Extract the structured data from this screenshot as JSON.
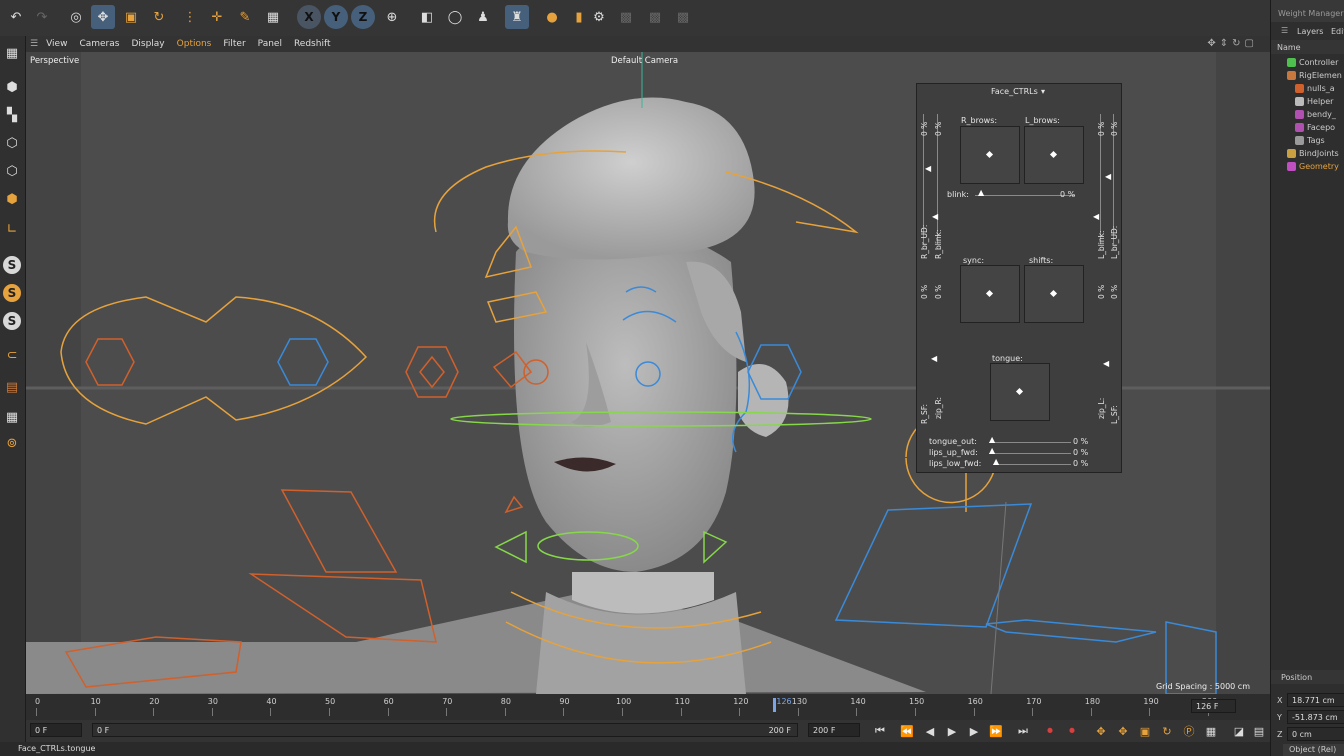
{
  "toolbar": {
    "icons": [
      "undo-icon",
      "redo-icon",
      "live-selection-icon",
      "move-icon",
      "scale-icon",
      "rotate-icon",
      "recent-tools-icon",
      "add-icon",
      "brush-icon",
      "checker-icon"
    ],
    "axes": {
      "x": "X",
      "y": "Y",
      "z": "Z"
    },
    "accent": "#46607c"
  },
  "viewport": {
    "menu": [
      "View",
      "Cameras",
      "Display",
      "Options",
      "Filter",
      "Panel",
      "Redshift"
    ],
    "view_name": "Perspective",
    "camera": "Default Camera",
    "grid_spacing": "Grid Spacing : 5000 cm"
  },
  "face_panel": {
    "title": "Face_CTRLs",
    "r_brows": "R_brows:",
    "l_brows": "L_brows:",
    "blink": "blink:",
    "blink_pct": "0 %",
    "sync": "sync:",
    "shifts": "shifts:",
    "tongue": "tongue:",
    "pct": "0 %",
    "r_br_ud": "R_br_UD:",
    "r_blink": "R_blink:",
    "l_blink": "L_blink:",
    "l_br_ud": "L_br_UD:",
    "r_sf": "R_SF:",
    "zip_r": "zip_R:",
    "zip_l": "zip_L:",
    "l_sf": "L_SF:",
    "sliders": [
      {
        "label": "tongue_out:",
        "value": "0 %"
      },
      {
        "label": "lips_up_fwd:",
        "value": "0 %"
      },
      {
        "label": "lips_low_fwd:",
        "value": "0 %"
      }
    ]
  },
  "right_panel": {
    "title": "Weight Manager",
    "tabs": [
      "Layers",
      "Edit"
    ],
    "name_header": "Name",
    "objects": [
      {
        "label": "Controller",
        "color": "#4fbf4f",
        "indent": 0
      },
      {
        "label": "RigElemen",
        "color": "#c8783c",
        "indent": 0
      },
      {
        "label": "nulls_a",
        "color": "#d0602c",
        "indent": 1
      },
      {
        "label": "Helper",
        "color": "#bbbbbb",
        "indent": 1
      },
      {
        "label": "bendy_",
        "color": "#b050b0",
        "indent": 1
      },
      {
        "label": "Facepo",
        "color": "#b050b0",
        "indent": 1
      },
      {
        "label": "Tags",
        "color": "#9a9a9a",
        "indent": 1
      },
      {
        "label": "BindJoints",
        "color": "#c8a040",
        "indent": 0
      },
      {
        "label": "Geometry",
        "color": "#c050c0",
        "indent": 0,
        "highlight": true
      }
    ],
    "position_title": "Position",
    "x_value": "18.771 cm",
    "y_value": "-51.873 cm",
    "z_value": "0 cm",
    "x_label": "X",
    "y_label": "Y",
    "z_label": "Z",
    "object_mode": "Object (Rel)"
  },
  "timeline": {
    "ticks": [
      "0",
      "10",
      "20",
      "30",
      "40",
      "50",
      "60",
      "70",
      "80",
      "90",
      "100",
      "110",
      "120",
      "130",
      "140",
      "150",
      "160",
      "170",
      "180",
      "190",
      "200"
    ],
    "current_frame": "126",
    "current_display": "126 F"
  },
  "transport": {
    "start_field": "0 F",
    "start_field2": "0 F",
    "end_field": "200 F",
    "end_field2": "200 F"
  },
  "status": {
    "text": "Face_CTRLs.tongue"
  }
}
